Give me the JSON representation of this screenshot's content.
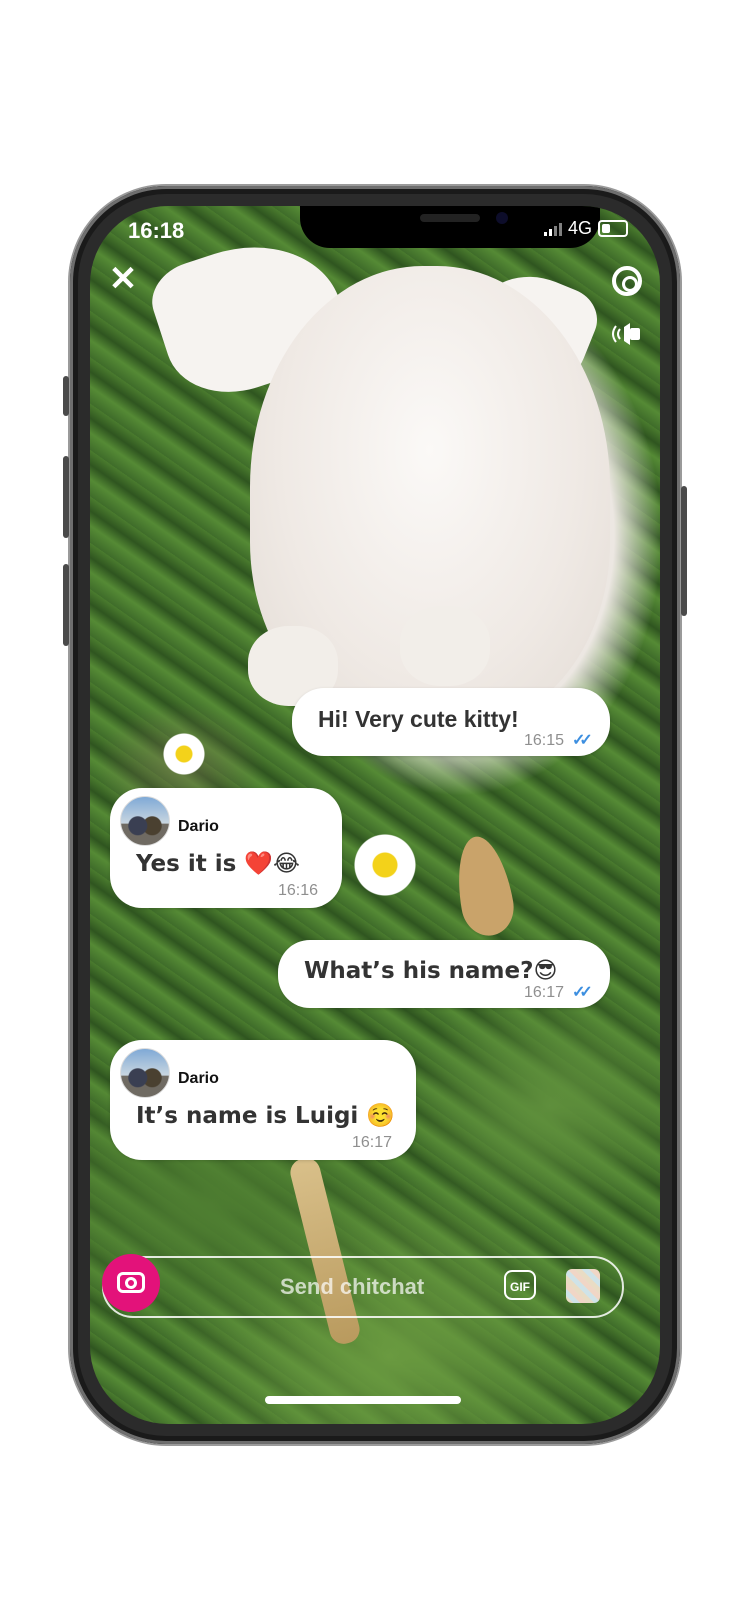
{
  "status_bar": {
    "time": "16:18",
    "network": "4G"
  },
  "messages": [
    {
      "direction": "outgoing",
      "text": "Hi! Very cute kitty!",
      "time": "16:15",
      "ticks": "✓✓"
    },
    {
      "direction": "incoming",
      "sender": "Dario",
      "text": "Yes it is ❤️😂",
      "time": "16:16"
    },
    {
      "direction": "outgoing",
      "text": "What’s his name?😎",
      "time": "16:17",
      "ticks": "✓✓"
    },
    {
      "direction": "incoming",
      "sender": "Dario",
      "text": "It’s name is Luigi ☺️",
      "time": "16:17"
    }
  ],
  "composer": {
    "placeholder": "Send chitchat",
    "gif_label": "GIF"
  },
  "colors": {
    "accent": "#e3127a",
    "read_ticks": "#3d8fe0"
  },
  "icons": [
    "close-icon",
    "timer-icon",
    "sound-icon",
    "camera-icon",
    "gif-icon",
    "sticker-icon"
  ]
}
